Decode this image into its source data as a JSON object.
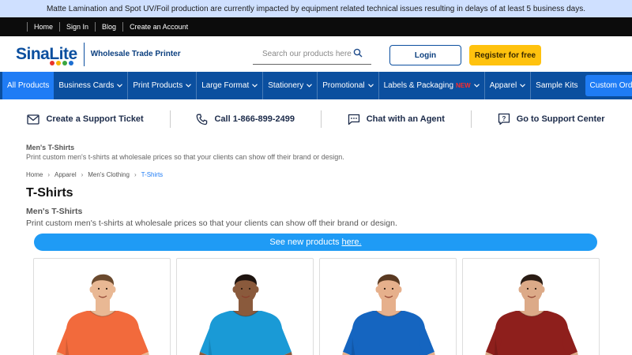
{
  "announcement": "Matte Lamination and Spot UV/Foil production are currently impacted by equipment related technical issues resulting in delays of at least 5 business days.",
  "top_links": [
    "Home",
    "Sign In",
    "Blog",
    "Create an Account"
  ],
  "logo": {
    "text": "SinaLite",
    "tagline": "Wholesale Trade Printer",
    "dot_colors": [
      "#e8352b",
      "#f7b500",
      "#3aa641",
      "#1d6fd1"
    ]
  },
  "search": {
    "placeholder": "Search our products here"
  },
  "buttons": {
    "login": "Login",
    "register": "Register for free"
  },
  "nav": [
    {
      "label": "All Products",
      "chevron": false
    },
    {
      "label": "Business Cards",
      "chevron": true
    },
    {
      "label": "Print Products",
      "chevron": true
    },
    {
      "label": "Large Format",
      "chevron": true
    },
    {
      "label": "Stationery",
      "chevron": true
    },
    {
      "label": "Promotional",
      "chevron": true
    },
    {
      "label": "Labels & Packaging",
      "chevron": true,
      "tag": "NEW"
    },
    {
      "label": "Apparel",
      "chevron": true
    },
    {
      "label": "Sample Kits",
      "chevron": false
    },
    {
      "label": "Custom Order",
      "chevron": true
    }
  ],
  "support": [
    {
      "label": "Create a Support Ticket",
      "icon": "mail-icon"
    },
    {
      "label": "Call 1-866-899-2499",
      "icon": "phone-icon"
    },
    {
      "label": "Chat with an Agent",
      "icon": "chat-icon"
    },
    {
      "label": "Go to Support Center",
      "icon": "help-icon"
    }
  ],
  "category": {
    "small_title": "Men's T-Shirts",
    "small_desc": "Print custom men's t-shirts at wholesale prices so that your clients can show off their brand or design."
  },
  "breadcrumb": [
    "Home",
    "Apparel",
    "Men's Clothing",
    "T-Shirts"
  ],
  "page": {
    "title": "T-Shirts",
    "subtitle": "Men's T-Shirts",
    "description": "Print custom men's t-shirts at wholesale prices so that your clients can show off their brand or design."
  },
  "banner": {
    "text": "See new products",
    "link": "here."
  },
  "products": [
    {
      "shirt_color": "#f26a3c",
      "skin": "#e9b894",
      "hair": "#6b4a2e"
    },
    {
      "shirt_color": "#1a9ad6",
      "skin": "#8a5a3c",
      "hair": "#1e1410"
    },
    {
      "shirt_color": "#1565c0",
      "skin": "#e6b08c",
      "hair": "#5a3a22"
    },
    {
      "shirt_color": "#8e1f1c",
      "skin": "#dcaa88",
      "hair": "#2a1c14"
    }
  ],
  "colors": {
    "brand_blue": "#0b4f9f",
    "accent_blue": "#1f7cf5",
    "yellow": "#ffc20e",
    "banner_blue": "#1f9bf5"
  }
}
